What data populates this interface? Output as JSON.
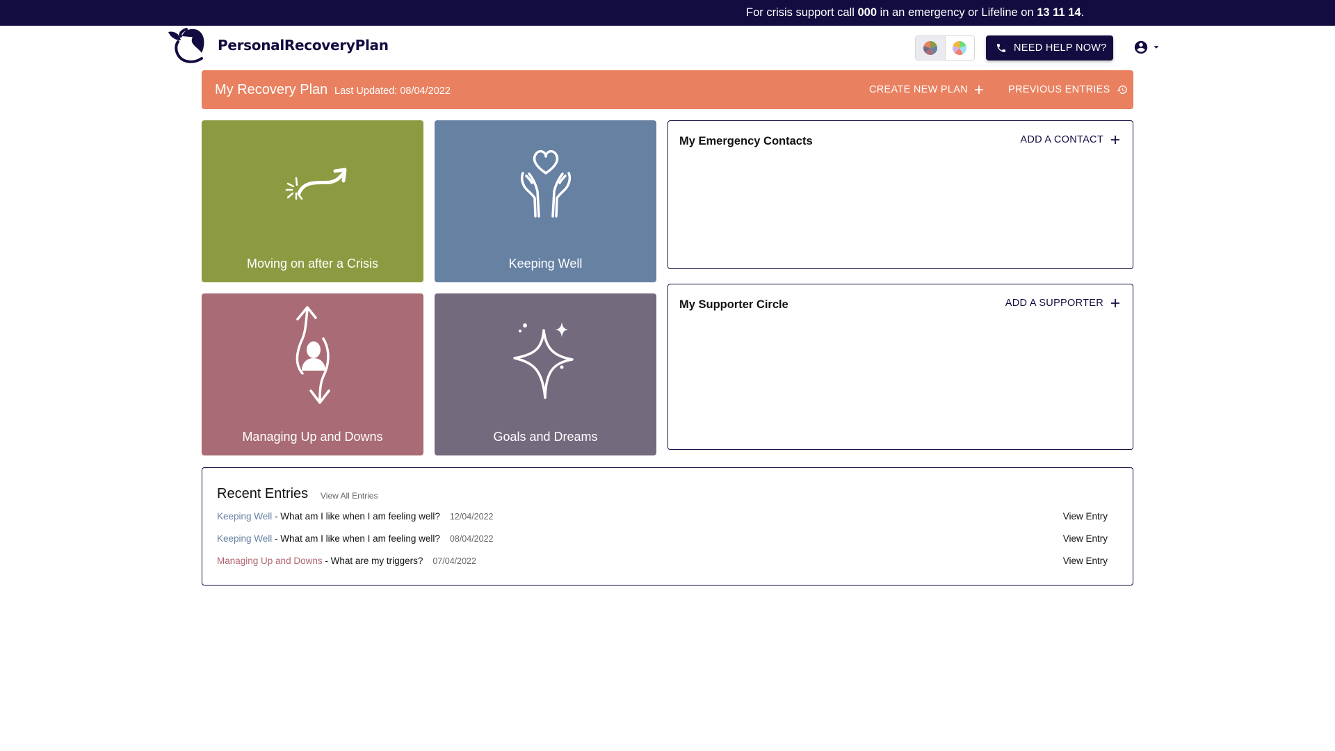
{
  "crisis_banner": {
    "prefix": "For crisis support call ",
    "emergency_number": "000",
    "middle": " in an emergency or Lifeline on ",
    "lifeline_number": "13 11 14",
    "suffix": "."
  },
  "header": {
    "brand": "PersonalRecoveryPlan",
    "theme_options": [
      "muted-palette",
      "bright-palette"
    ],
    "help_button": "NEED HELP NOW?",
    "account_icon": "account-circle-icon"
  },
  "plan_bar": {
    "title": "My Recovery Plan",
    "last_updated": "Last Updated: 08/04/2022",
    "create_label": "CREATE NEW PLAN",
    "previous_label": "PREVIOUS ENTRIES",
    "color": "#e98060"
  },
  "tiles": [
    {
      "label": "Moving on after a Crisis",
      "icon": "arrow-breakthrough-icon",
      "color": "#8c9b41"
    },
    {
      "label": "Keeping Well",
      "icon": "hands-heart-icon",
      "color": "#6781a3"
    },
    {
      "label": "Managing Up and Downs",
      "icon": "person-ups-downs-icon",
      "color": "#a96b75"
    },
    {
      "label": "Goals and Dreams",
      "icon": "sparkle-icon",
      "color": "#736a7e"
    }
  ],
  "emergency_contacts": {
    "title": "My Emergency Contacts",
    "add_label": "ADD A CONTACT"
  },
  "supporter_circle": {
    "title": "My Supporter Circle",
    "add_label": "ADD A SUPPORTER"
  },
  "recent_entries": {
    "title": "Recent Entries",
    "view_all": "View All Entries",
    "items": [
      {
        "category": "Keeping Well",
        "question": " - What am I like when I am feeling well?",
        "date": "12/04/2022",
        "action": "View Entry"
      },
      {
        "category": "Keeping Well",
        "question": " - What am I like when I am feeling well?",
        "date": "08/04/2022",
        "action": "View Entry"
      },
      {
        "category": "Managing Up and Downs",
        "question": " - What are my triggers?",
        "date": "07/04/2022",
        "action": "View Entry"
      }
    ]
  }
}
